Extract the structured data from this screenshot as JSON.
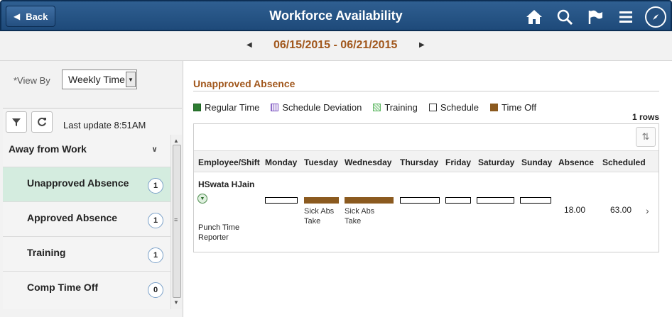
{
  "header": {
    "back_label": "Back",
    "title": "Workforce Availability",
    "icons": [
      "home-icon",
      "search-icon",
      "flag-icon",
      "menu-icon",
      "compass-icon"
    ]
  },
  "date_bar": {
    "range": "06/15/2015 - 06/21/2015"
  },
  "view_by": {
    "label": "*View By",
    "value": "Weekly Time"
  },
  "toolbar": {
    "last_update": "Last update 8:51AM"
  },
  "sidebar": {
    "group": "Away from Work",
    "items": [
      {
        "label": "Unapproved Absence",
        "count": "1",
        "selected": true
      },
      {
        "label": "Approved Absence",
        "count": "1",
        "selected": false
      },
      {
        "label": "Training",
        "count": "1",
        "selected": false
      },
      {
        "label": "Comp Time Off",
        "count": "0",
        "selected": false
      }
    ]
  },
  "main": {
    "section_title": "Unapproved Absence",
    "legend": [
      {
        "label": "Regular Time",
        "color": "#2e7d32"
      },
      {
        "label": "Schedule Deviation",
        "color": "#b39ddb"
      },
      {
        "label": "Training",
        "color": "#a5d6a7"
      },
      {
        "label": "Schedule",
        "color": "#ffffff"
      },
      {
        "label": "Time Off",
        "color": "#8b5a1f"
      }
    ],
    "rows_count": "1 rows",
    "columns": [
      "Employee/Shift",
      "Monday",
      "Tuesday",
      "Wednesday",
      "Thursday",
      "Friday",
      "Saturday",
      "Sunday",
      "Absence",
      "Scheduled"
    ],
    "row": {
      "employee": "HSwata HJain",
      "shift": "Punch Time Reporter",
      "tuesday_label": "Sick Abs Take",
      "wednesday_label": "Sick Abs Take",
      "absence": "18.00",
      "scheduled": "63.00"
    }
  }
}
